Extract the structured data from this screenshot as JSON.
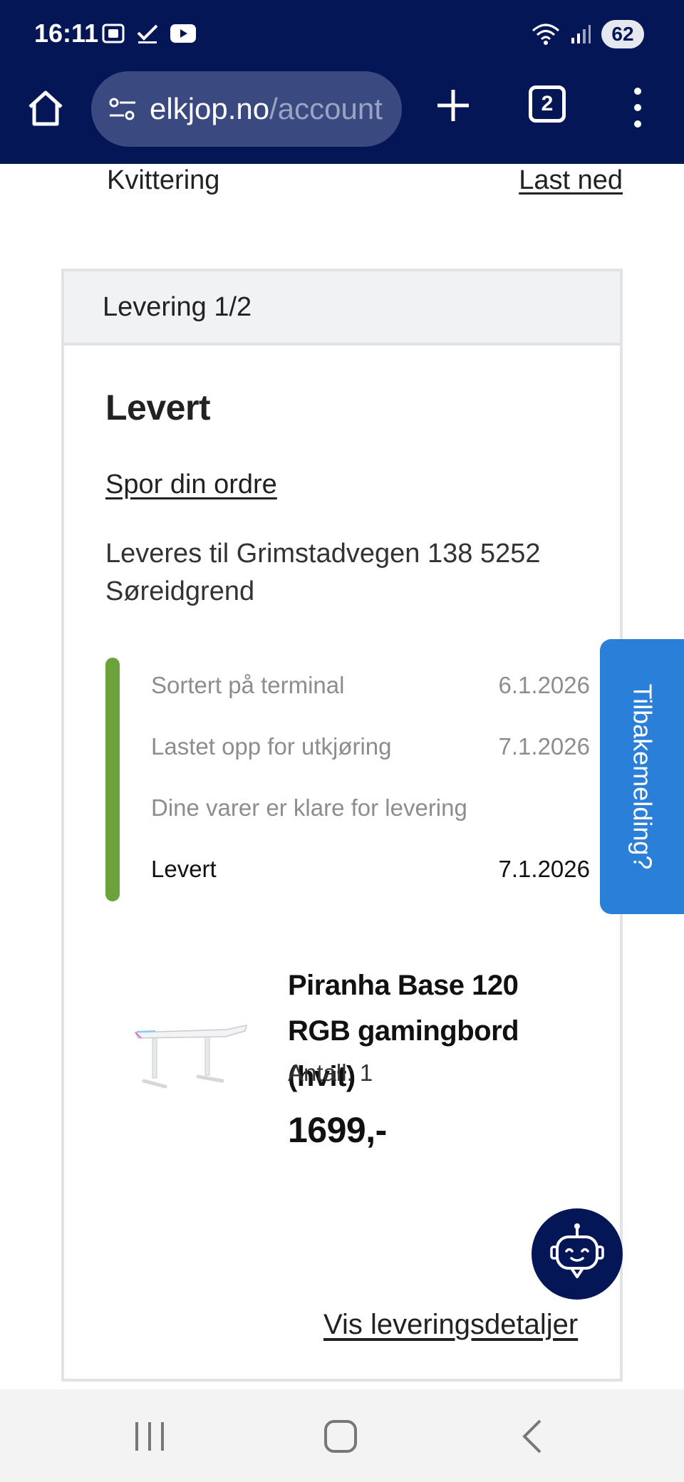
{
  "status_bar": {
    "time": "16:11",
    "battery": "62",
    "bg_color": "#041656"
  },
  "browser": {
    "url_domain": "elkjop.no",
    "url_path": "/account",
    "tab_count": "2",
    "icons": [
      "home-icon",
      "site-settings-icon",
      "new-tab-icon",
      "tab-switcher-icon",
      "more-menu-icon"
    ]
  },
  "receipt": {
    "label": "Kvittering",
    "download": "Last ned"
  },
  "delivery": {
    "header": "Levering 1/2",
    "status": "Levert",
    "track_link": "Spor din ordre",
    "address": "Leveres til Grimstadvegen 138 5252 Søreidgrend",
    "timeline_color": "#6aa33c",
    "timeline": [
      {
        "label": "Sortert på terminal",
        "date": "6.1.2026"
      },
      {
        "label": "Lastet opp for utkjøring",
        "date": "7.1.2026"
      },
      {
        "label": "Dine varer er klare for levering",
        "date": ""
      },
      {
        "label": "Levert",
        "date": "7.1.2026"
      }
    ],
    "product": {
      "name": "Piranha Base 120 RGB gamingbord (hvit)",
      "quantity": "Antall: 1",
      "price": "1699,-"
    },
    "details_link": "Vis leveringsdetaljer"
  },
  "feedback": {
    "label": "Tilbakemelding?",
    "color": "#2a7fd8"
  },
  "chatbot": {
    "icon": "chatbot-icon"
  },
  "nav": {
    "icons": [
      "recent-apps-icon",
      "home-nav-icon",
      "back-icon"
    ]
  }
}
